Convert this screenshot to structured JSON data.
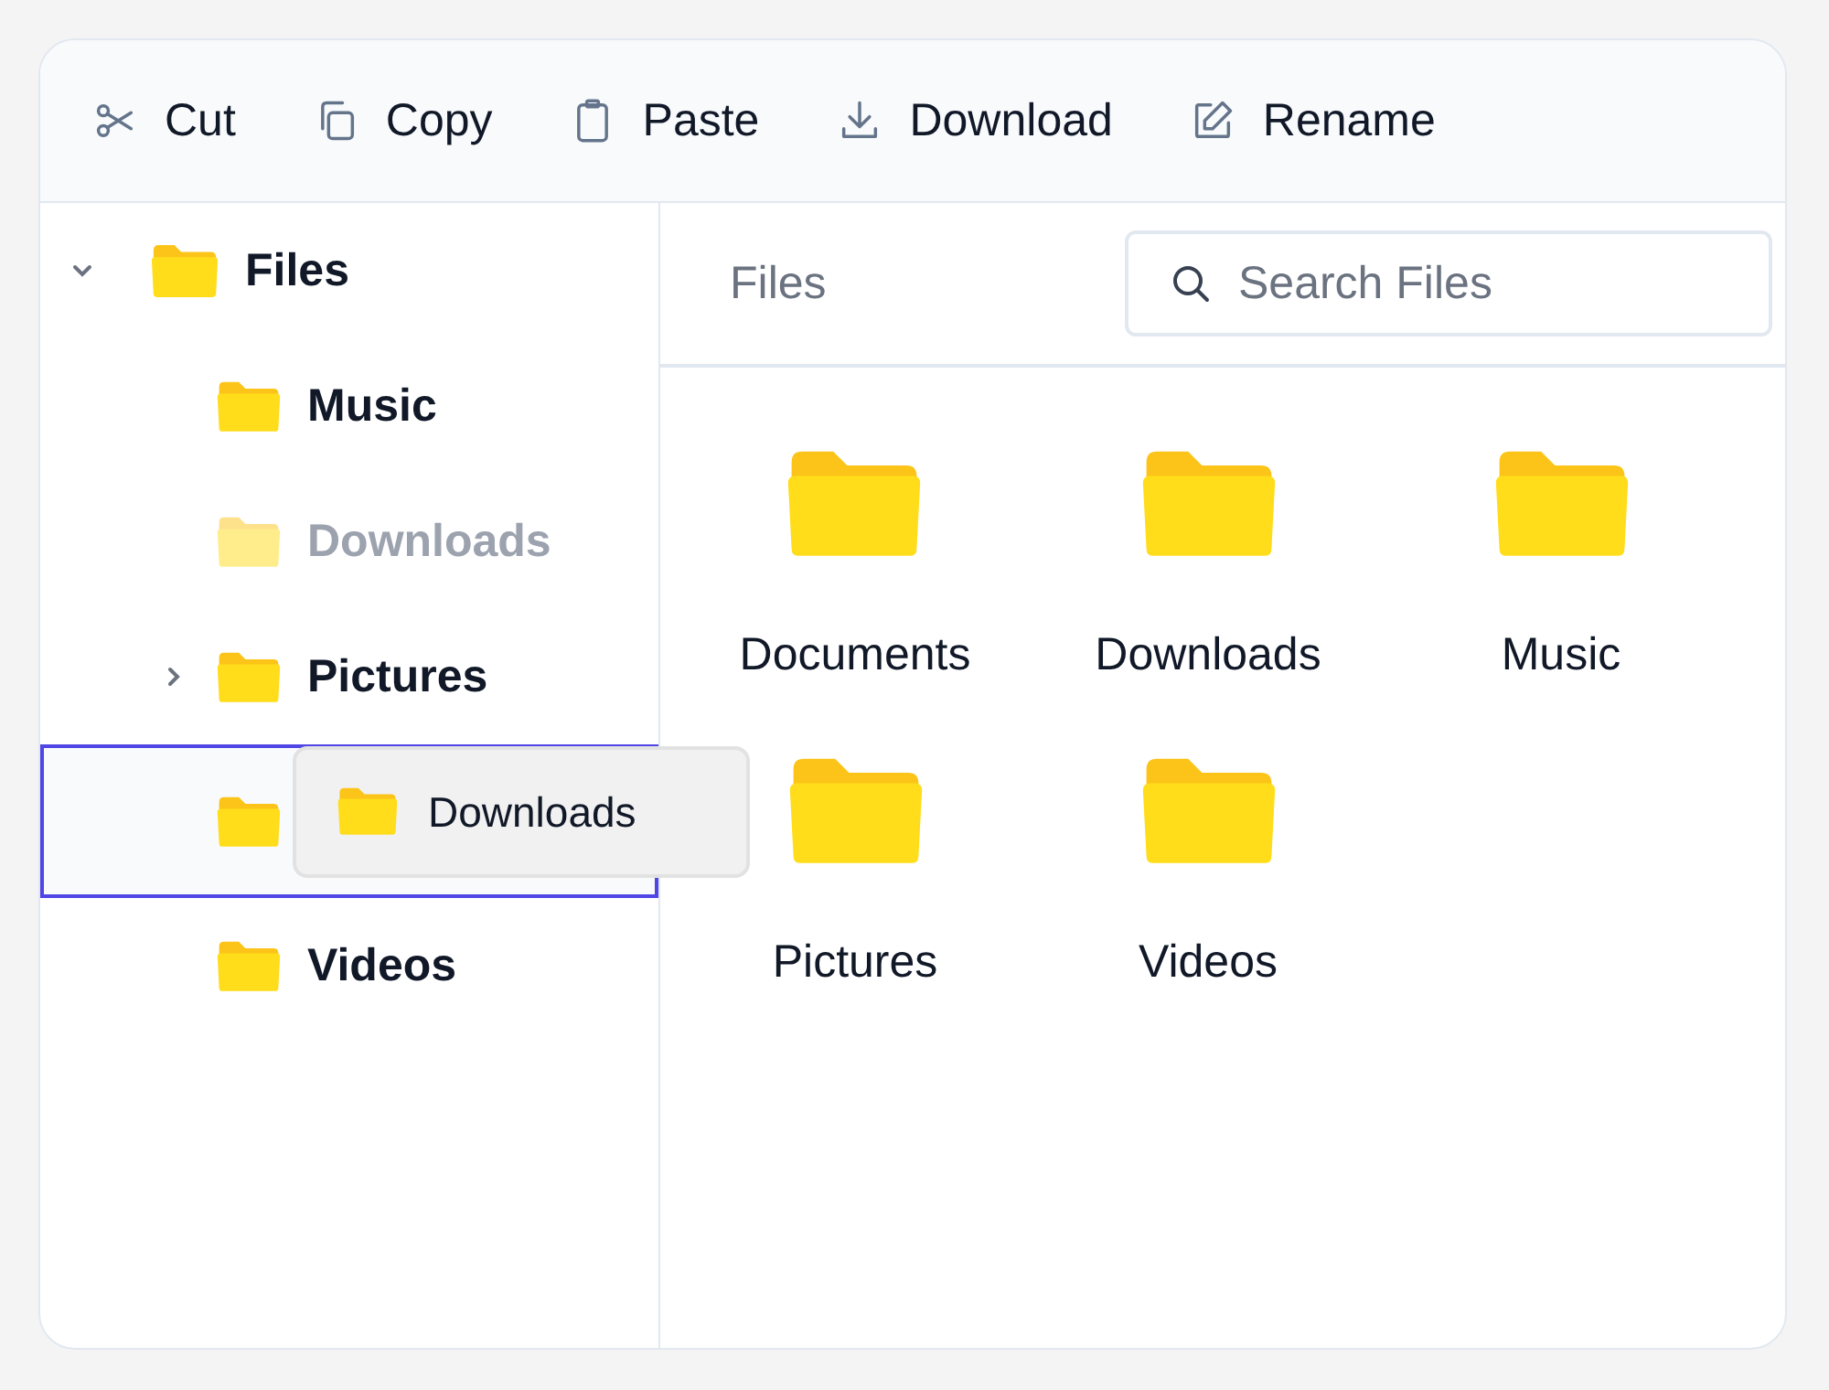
{
  "toolbar": [
    {
      "kind": "cut",
      "label": "Cut"
    },
    {
      "kind": "copy",
      "label": "Copy"
    },
    {
      "kind": "paste",
      "label": "Paste"
    },
    {
      "kind": "download",
      "label": "Download"
    },
    {
      "kind": "rename",
      "label": "Rename"
    }
  ],
  "tree": [
    {
      "label": "Files",
      "expanded": true,
      "children": [
        {
          "label": "Music",
          "dragging": false,
          "drop_target": false
        },
        {
          "label": "Downloads",
          "dragging": true,
          "drop_target": false
        },
        {
          "label": "Pictures",
          "expanded": false,
          "dragging": false,
          "drop_target": false,
          "has_children": true
        },
        {
          "dragging": false,
          "drop_target": true
        },
        {
          "label": "Videos",
          "dragging": false,
          "drop_target": false
        }
      ]
    }
  ],
  "drag_ghost": {
    "label": "Downloads"
  },
  "breadcrumb": "Files",
  "search": {
    "placeholder": "Search Files"
  },
  "folders": [
    {
      "label": "Documents"
    },
    {
      "label": "Downloads"
    },
    {
      "label": "Music"
    },
    {
      "label": "Pictures"
    },
    {
      "label": "Videos"
    }
  ]
}
